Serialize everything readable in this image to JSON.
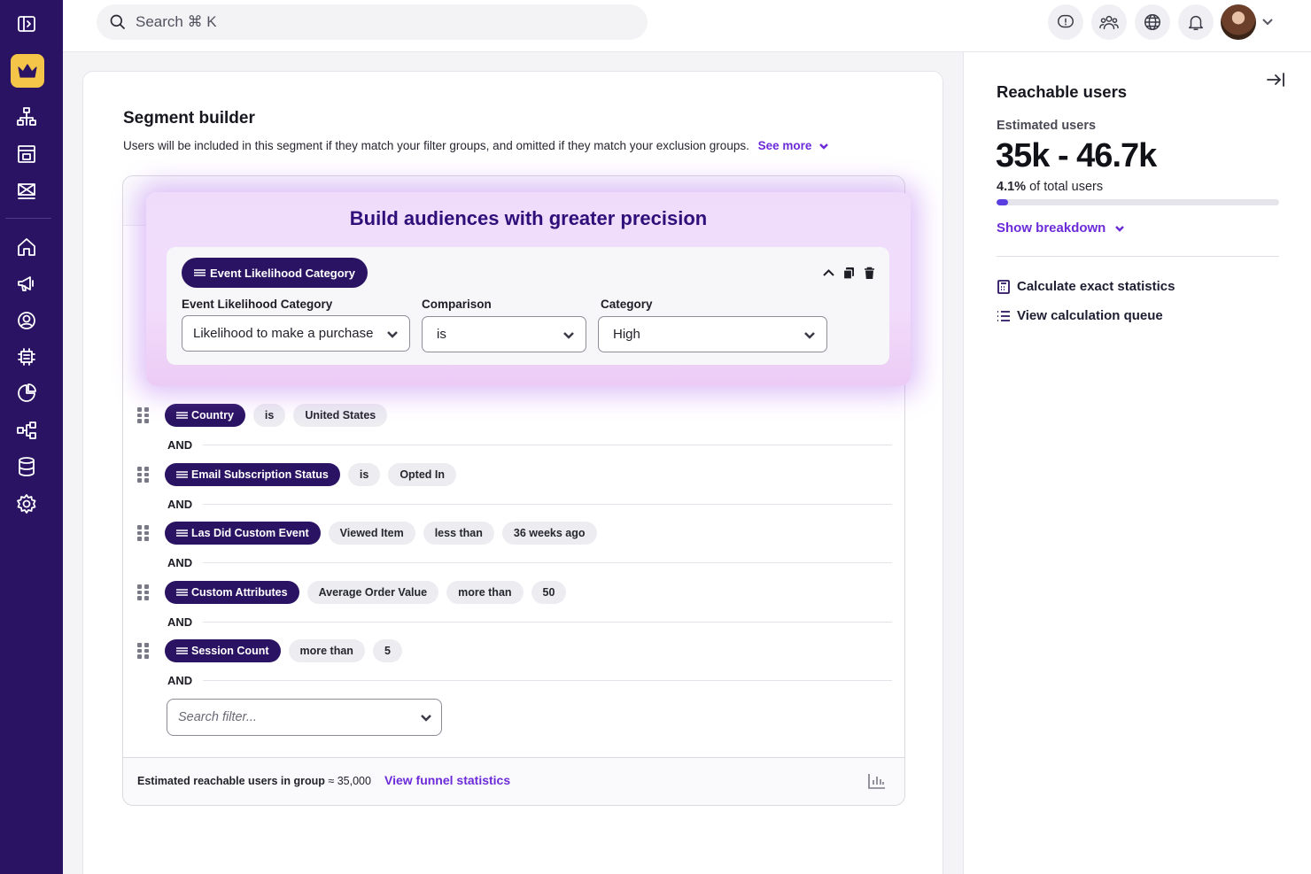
{
  "topbar": {
    "search_placeholder": "Search ⌘ K"
  },
  "sidebar": {
    "items": [
      {
        "icon": "sidebar-toggle-icon"
      },
      {
        "icon": "crown-icon",
        "active": true
      },
      {
        "icon": "org-chart-icon"
      },
      {
        "icon": "dashboard-icon"
      },
      {
        "icon": "flag-icon"
      },
      {
        "icon": "home-icon"
      },
      {
        "icon": "megaphone-icon"
      },
      {
        "icon": "user-circle-icon"
      },
      {
        "icon": "data-chip-icon"
      },
      {
        "icon": "pie-chart-icon"
      },
      {
        "icon": "flow-icon"
      },
      {
        "icon": "database-icon"
      },
      {
        "icon": "settings-icon"
      }
    ]
  },
  "segment": {
    "title": "Segment builder",
    "description": "Users will be included in this segment if they match your filter groups, and omitted if they match your exclusion groups.",
    "see_more": "See more"
  },
  "highlight": {
    "title": "Build audiences with greater precision",
    "filter_pill": "Event Likelihood Category",
    "fields": [
      {
        "label": "Event Likelihood Category",
        "value": "Likelihood to make a purchase"
      },
      {
        "label": "Comparison",
        "value": "is"
      },
      {
        "label": "Category",
        "value": "High"
      }
    ]
  },
  "filters": [
    {
      "name": "Country",
      "parts": [
        "is",
        "United States"
      ]
    },
    {
      "name": "Email Subscription Status",
      "parts": [
        "is",
        "Opted In"
      ]
    },
    {
      "name": "Las Did Custom Event",
      "parts": [
        "Viewed Item",
        "less than",
        "36 weeks ago"
      ]
    },
    {
      "name": "Custom Attributes",
      "parts": [
        "Average Order Value",
        "more than",
        "50"
      ]
    },
    {
      "name": "Session Count",
      "parts": [
        "more than",
        "5"
      ]
    }
  ],
  "and_label": "AND",
  "filter_search_placeholder": "Search filter...",
  "group_footer": {
    "estimate_label": "Estimated reachable users in group",
    "estimate_value": "≈ 35,000",
    "funnel_link": "View funnel statistics"
  },
  "reachable": {
    "title": "Reachable users",
    "estimated_label": "Estimated users",
    "range": "35k - 46.7k",
    "percent": "4.1%",
    "percent_suffix": "of total users",
    "percent_value": 0.041,
    "show_breakdown": "Show breakdown",
    "calc_exact": "Calculate exact statistics",
    "calc_queue": "View calculation queue"
  },
  "colors": {
    "sidebar_bg": "#2b1363",
    "accent": "#6c2bd9",
    "crown_bg": "#f5c54a",
    "pill_dark": "#2b1363",
    "progress": "#5a3ee0"
  }
}
